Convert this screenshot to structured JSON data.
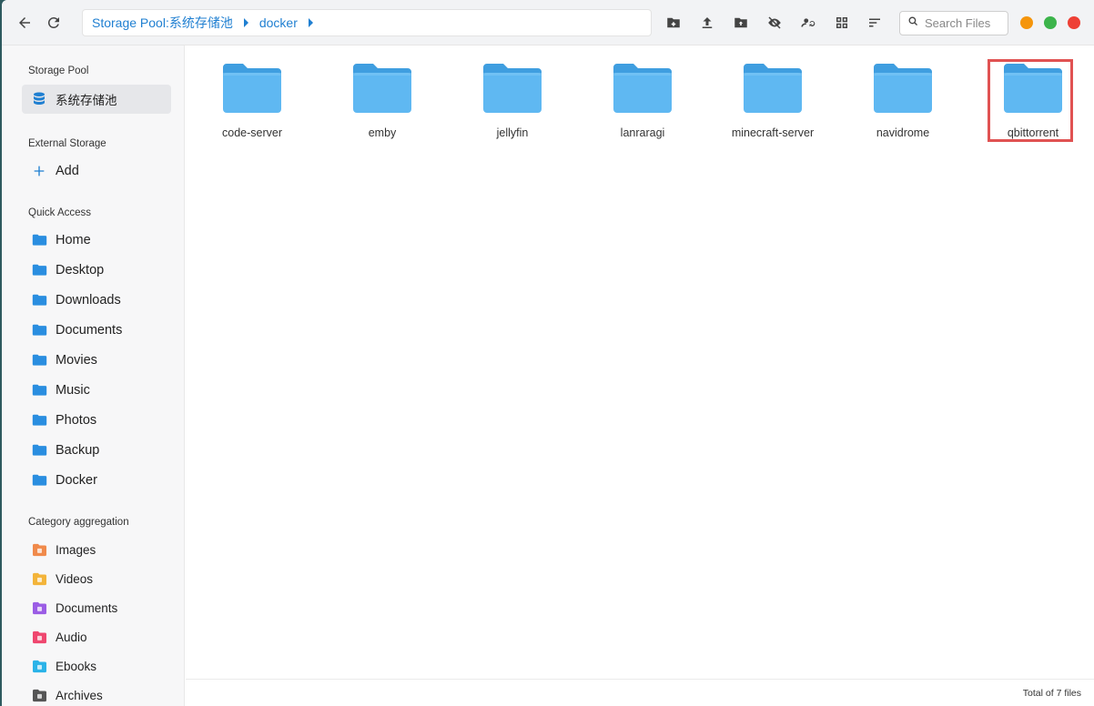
{
  "toolbar": {
    "path": [
      "Storage Pool:系统存储池",
      "docker"
    ],
    "search_placeholder": "Search Files",
    "icons": [
      "back-icon",
      "refresh-icon",
      "new-folder-icon",
      "upload-icon",
      "upload-folder-icon",
      "hide-icon",
      "sync-icon",
      "grid-view-icon",
      "sort-icon"
    ],
    "window_controls": {
      "minimize_color": "#f5950b",
      "maximize_color": "#3cb44b",
      "close_color": "#ee4035"
    }
  },
  "sidebar": {
    "storage_pool_title": "Storage Pool",
    "storage_pool_item": "系统存储池",
    "external_title": "External Storage",
    "add_label": "Add",
    "quick_title": "Quick Access",
    "quick_items": [
      "Home",
      "Desktop",
      "Downloads",
      "Documents",
      "Movies",
      "Music",
      "Photos",
      "Backup",
      "Docker"
    ],
    "category_title": "Category aggregation",
    "category_items": [
      {
        "label": "Images",
        "color": "#f08a4b"
      },
      {
        "label": "Videos",
        "color": "#f3b43a"
      },
      {
        "label": "Documents",
        "color": "#9b5de5"
      },
      {
        "label": "Audio",
        "color": "#ef476f"
      },
      {
        "label": "Ebooks",
        "color": "#2bb3e8"
      },
      {
        "label": "Archives",
        "color": "#555555"
      }
    ]
  },
  "files": [
    "code-server",
    "emby",
    "jellyfin",
    "lanraragi",
    "minecraft-server",
    "navidrome",
    "qbittorrent"
  ],
  "highlighted_file": "qbittorrent",
  "status": {
    "total": "Total of 7 files"
  },
  "colors": {
    "accent": "#1f7fd1",
    "folder": "#5fb8f2",
    "folder_tab": "#3f9ee0",
    "highlight": "#e05252"
  }
}
